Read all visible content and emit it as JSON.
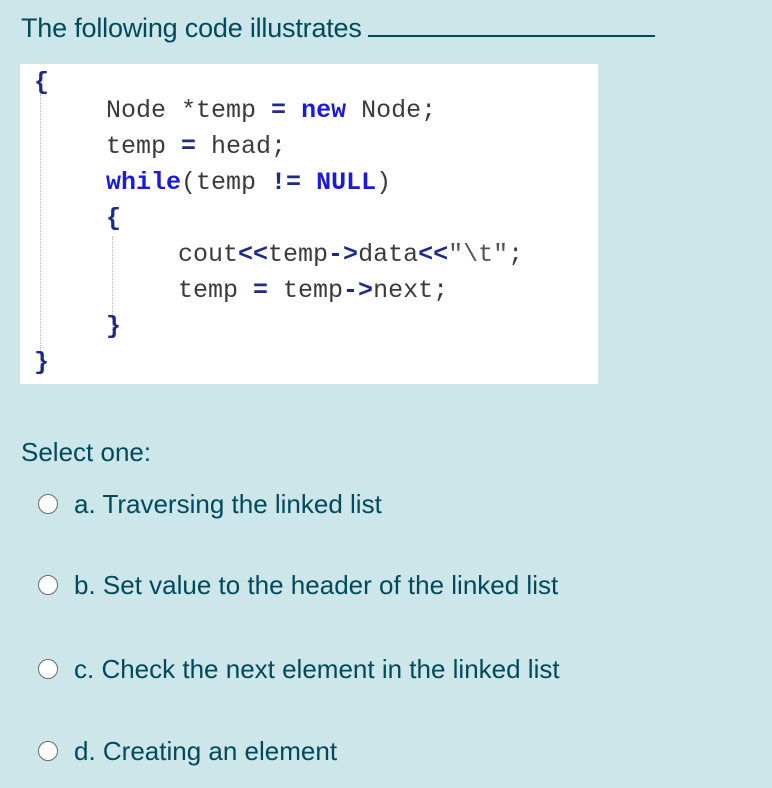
{
  "question": {
    "text": "The following code illustrates"
  },
  "code": {
    "lines": [
      {
        "tokens": [
          {
            "t": "{",
            "c": "brace"
          }
        ]
      },
      {
        "tokens": [
          {
            "t": "Node *temp ",
            "c": ""
          },
          {
            "t": "=",
            "c": "op"
          },
          {
            "t": " ",
            "c": ""
          },
          {
            "t": "new",
            "c": "kw"
          },
          {
            "t": " Node;",
            "c": ""
          }
        ]
      },
      {
        "tokens": [
          {
            "t": "temp ",
            "c": ""
          },
          {
            "t": "=",
            "c": "op"
          },
          {
            "t": " head;",
            "c": ""
          }
        ]
      },
      {
        "tokens": [
          {
            "t": "while",
            "c": "kw"
          },
          {
            "t": "(temp ",
            "c": ""
          },
          {
            "t": "!=",
            "c": "op"
          },
          {
            "t": " ",
            "c": ""
          },
          {
            "t": "NULL",
            "c": "kw"
          },
          {
            "t": ")",
            "c": ""
          }
        ]
      },
      {
        "tokens": [
          {
            "t": "{",
            "c": "brace"
          }
        ]
      },
      {
        "tokens": [
          {
            "t": "cout",
            "c": ""
          },
          {
            "t": "<<",
            "c": "op"
          },
          {
            "t": "temp",
            "c": ""
          },
          {
            "t": "->",
            "c": "op"
          },
          {
            "t": "data",
            "c": ""
          },
          {
            "t": "<<",
            "c": "op"
          },
          {
            "t": "\"\\t\"",
            "c": "str"
          },
          {
            "t": ";",
            "c": ""
          }
        ]
      },
      {
        "tokens": [
          {
            "t": "temp ",
            "c": ""
          },
          {
            "t": "=",
            "c": "op"
          },
          {
            "t": " temp",
            "c": ""
          },
          {
            "t": "->",
            "c": "op"
          },
          {
            "t": "next;",
            "c": ""
          }
        ]
      },
      {
        "tokens": [
          {
            "t": "}",
            "c": "brace"
          }
        ]
      },
      {
        "tokens": [
          {
            "t": "}",
            "c": "brace"
          }
        ]
      }
    ]
  },
  "prompt": "Select one:",
  "options": [
    {
      "label": "a. Traversing the linked list",
      "selected": false
    },
    {
      "label": "b. Set value to the header of the linked list",
      "selected": false
    },
    {
      "label": "c. Check the next element in the linked list",
      "selected": false
    },
    {
      "label": "d. Creating an element",
      "selected": false
    }
  ]
}
